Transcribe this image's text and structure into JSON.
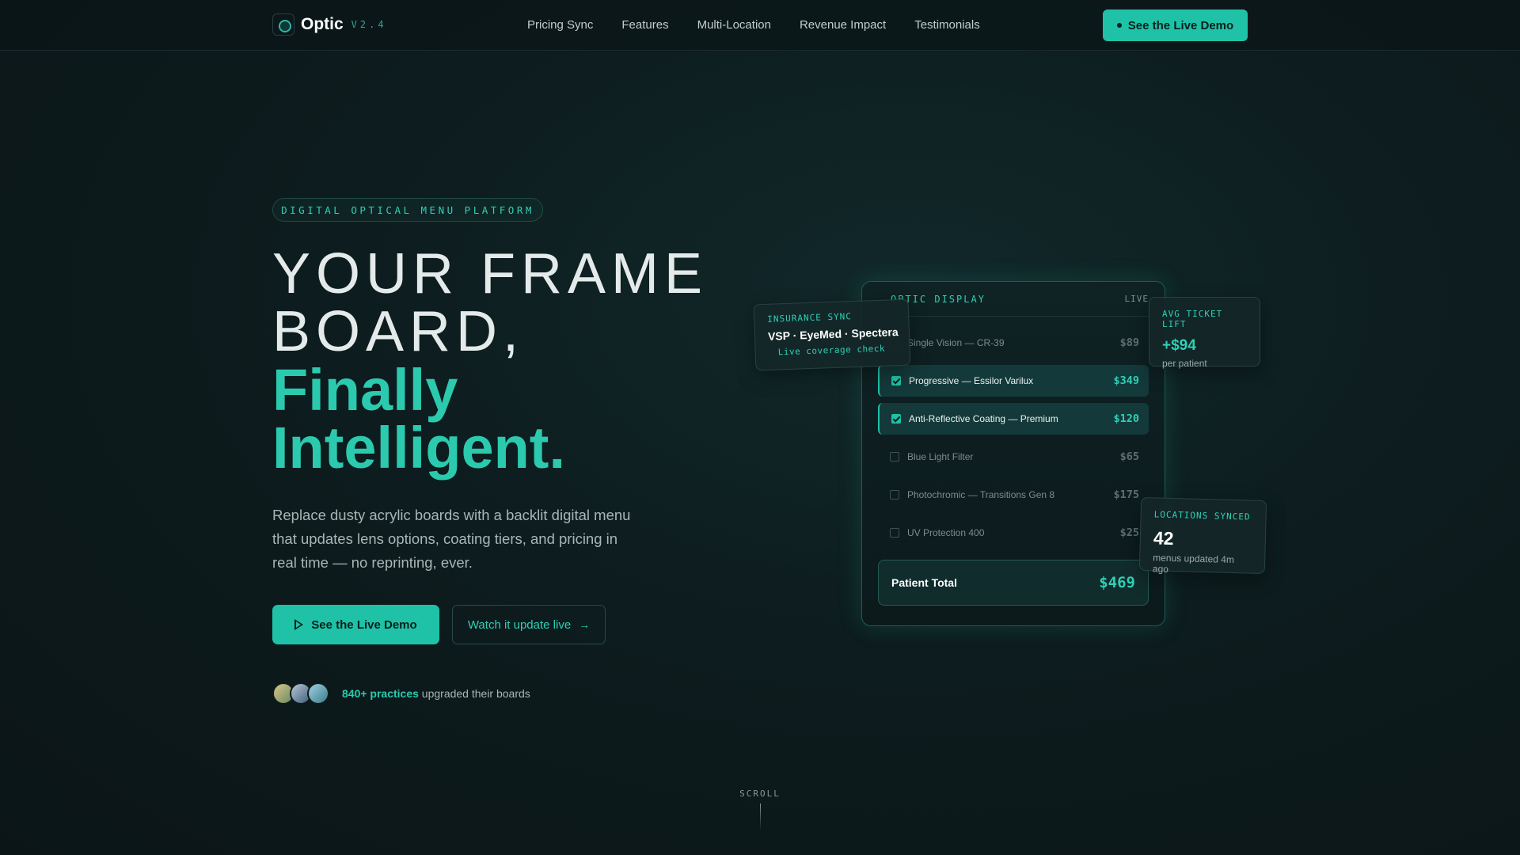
{
  "brand": {
    "name": "Optic",
    "version": "V2.4"
  },
  "nav": {
    "items": [
      "Pricing Sync",
      "Features",
      "Multi-Location",
      "Revenue Impact",
      "Testimonials"
    ],
    "cta": "See the Live Demo"
  },
  "hero": {
    "badge": "DIGITAL OPTICAL MENU PLATFORM",
    "headline_line1": "YOUR FRAME",
    "headline_line2": "BOARD,",
    "headline_accent1": "Finally",
    "headline_accent2": "Intelligent.",
    "subtitle": "Replace dusty acrylic boards with a backlit digital menu that updates lens options, coating tiers, and pricing in real time — no reprinting, ever.",
    "primary_cta": "See the Live Demo",
    "secondary_cta": "Watch it update live",
    "social_count": "840+ practices",
    "social_text": "upgraded their boards"
  },
  "display": {
    "title": "OPTIC DISPLAY",
    "status": "LIVE",
    "rows": [
      {
        "label": "Single Vision — CR-39",
        "price": "$89",
        "checked": false
      },
      {
        "label": "Progressive — Essilor Varilux",
        "price": "$349",
        "checked": true
      },
      {
        "label": "Anti-Reflective Coating — Premium",
        "price": "$120",
        "checked": true
      },
      {
        "label": "Blue Light Filter",
        "price": "$65",
        "checked": false
      },
      {
        "label": "Photochromic — Transitions Gen 8",
        "price": "$175",
        "checked": false
      },
      {
        "label": "UV Protection 400",
        "price": "$25",
        "checked": false
      }
    ],
    "total_label": "Patient Total",
    "total_value": "$469"
  },
  "insurance": {
    "label": "INSURANCE SYNC",
    "carriers": "VSP · EyeMed · Spectera",
    "note": "Live coverage check"
  },
  "ticket": {
    "label": "AVG TICKET LIFT",
    "value": "+$94",
    "sub": "per patient"
  },
  "locations": {
    "label": "LOCATIONS SYNCED",
    "value": "42",
    "sub": "menus updated 4m ago"
  },
  "scroll": {
    "label": "SCROLL"
  },
  "colors": {
    "accent": "#1fc2a7",
    "background": "#0d1c1e",
    "text_muted": "#a9b6b6"
  }
}
